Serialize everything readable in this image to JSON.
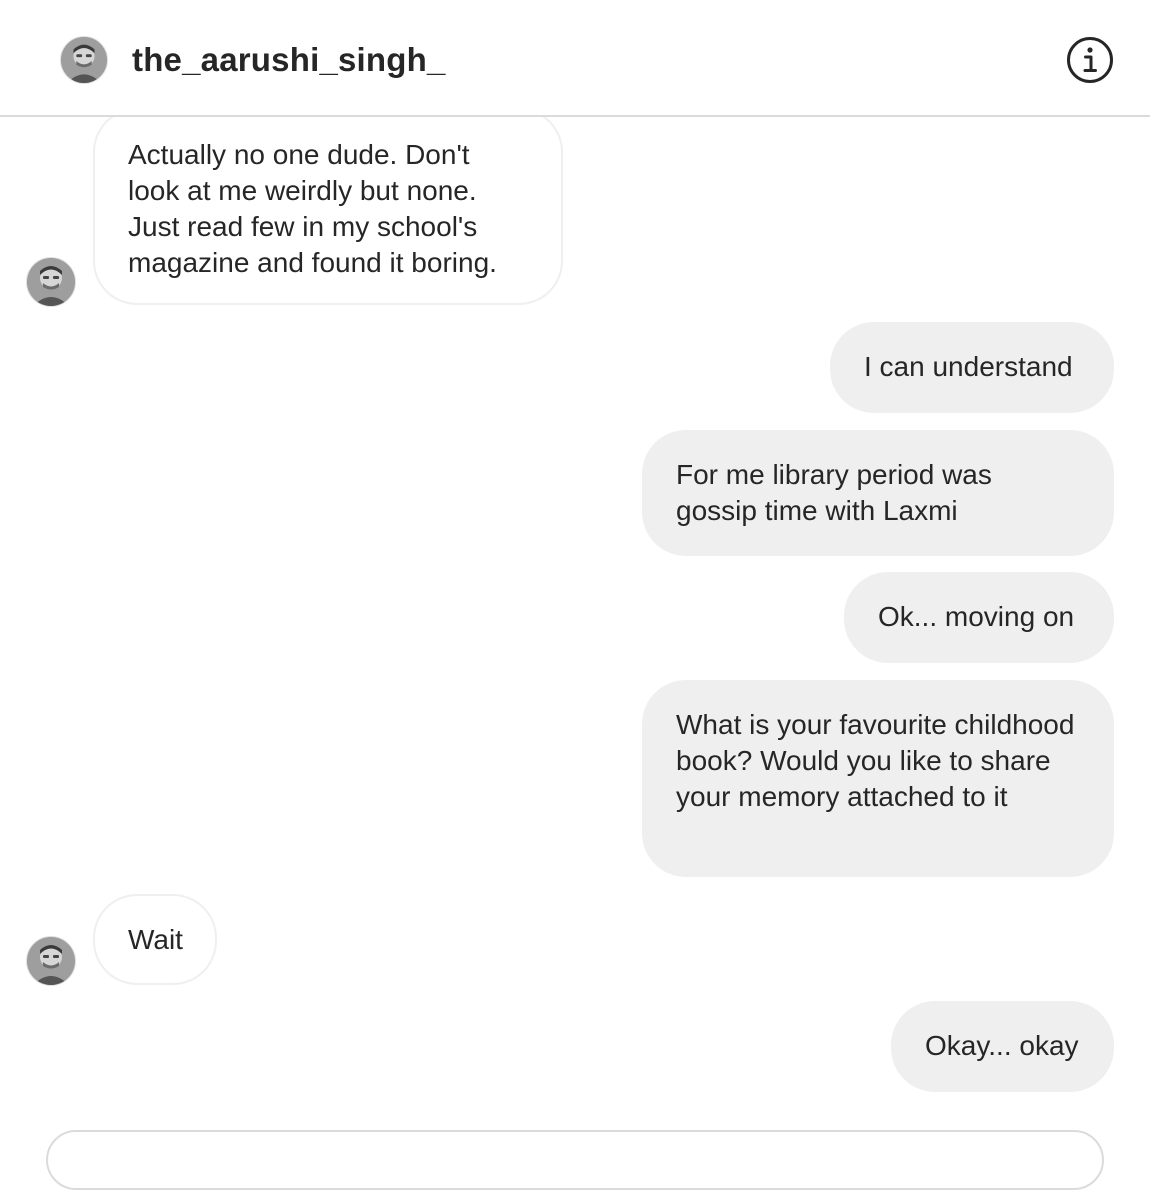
{
  "header": {
    "username": "the_aarushi_singh_",
    "avatar_icon": "profile-avatar",
    "info_icon": "info-icon"
  },
  "messages": [
    {
      "direction": "incoming",
      "text": "Actually no one dude. Don't look at me weirdly but none. Just read few in my school's magazine and found it boring."
    },
    {
      "direction": "outgoing",
      "text": "I can understand"
    },
    {
      "direction": "outgoing",
      "text": "For me library period was gossip time with Laxmi"
    },
    {
      "direction": "outgoing",
      "text": "Ok... moving on"
    },
    {
      "direction": "outgoing",
      "text": "What is your favourite childhood book? Would you like to share your memory attached to it"
    },
    {
      "direction": "incoming",
      "text": "Wait"
    },
    {
      "direction": "outgoing",
      "text": "Okay... okay"
    }
  ],
  "colors": {
    "outgoing_bubble": "#efefef",
    "incoming_border": "#efefef",
    "divider": "#dbdbdb",
    "text": "#262626"
  }
}
